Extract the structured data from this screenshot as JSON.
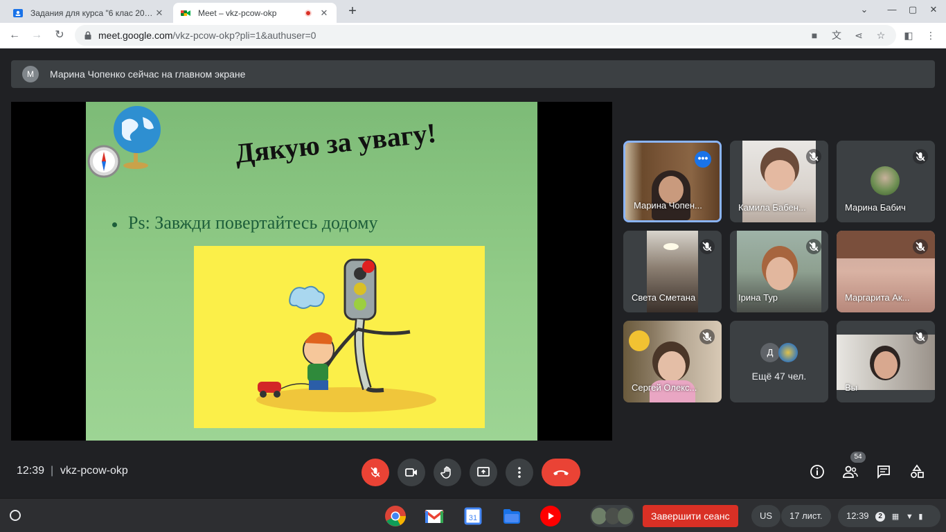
{
  "browser": {
    "tabs": [
      {
        "title": "Задания для курса \"6 клас 2022...",
        "active": false
      },
      {
        "title": "Meet – vkz-pcow-okp",
        "active": true
      }
    ],
    "url_host": "meet.google.com",
    "url_path": "/vkz-pcow-okp?pli=1&authuser=0"
  },
  "banner": {
    "avatar_letter": "М",
    "text": "Марина Чопенко сейчас на главном экране"
  },
  "slide": {
    "title": "Дякую за увагу!",
    "bullet": "Ps:  Завжди повертайтесь додому"
  },
  "tiles": [
    {
      "name": "Марина Чопен...",
      "muted": false,
      "pinned": true
    },
    {
      "name": "Камила Бабен...",
      "muted": true
    },
    {
      "name": "Марина Бабич",
      "muted": true
    },
    {
      "name": "Света Сметана",
      "muted": true
    },
    {
      "name": "Ірина Тур",
      "muted": true
    },
    {
      "name": "Маргарита Ак...",
      "muted": true
    },
    {
      "name": "Сергей Олекс...",
      "muted": true
    },
    {
      "name": "Ещё 47 чел.",
      "avatar_letter": "Д"
    },
    {
      "name": "Вы",
      "muted": true
    }
  ],
  "meeting": {
    "time": "12:39",
    "separator": "|",
    "code": "vkz-pcow-okp",
    "participants_count": "54"
  },
  "shelf": {
    "end_session": "Завершити сеанс",
    "keyboard": "US",
    "date": "17 лист.",
    "time": "12:39",
    "notifications": "2"
  },
  "colors": {
    "meet_bg": "#202124",
    "tile_bg": "#3c4043",
    "accent_blue": "#8ab4f8",
    "end_red": "#ea4335"
  }
}
